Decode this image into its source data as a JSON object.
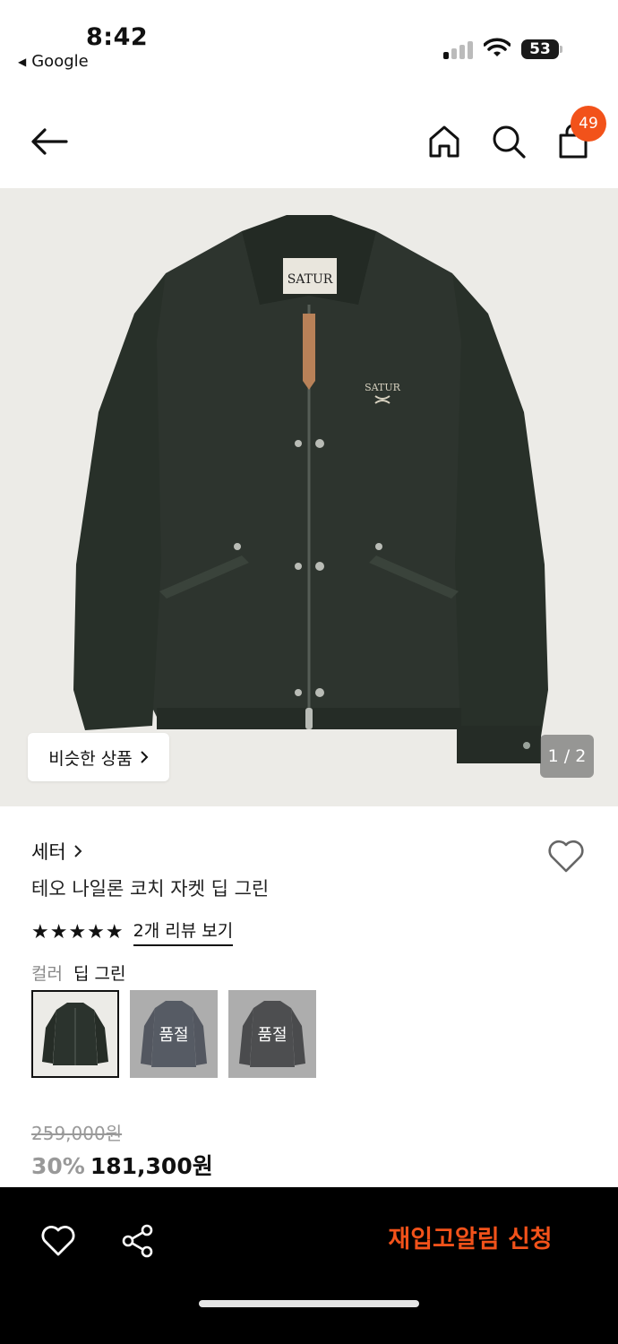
{
  "status_bar": {
    "time": "8:42",
    "back_app": "Google",
    "battery": "53"
  },
  "nav": {
    "cart_badge": "49",
    "icons": [
      "back-arrow-icon",
      "home-icon",
      "search-icon",
      "shopping-bag-icon"
    ]
  },
  "hero": {
    "similar_label": "비슷한 상품",
    "page_indicator": "1 / 2",
    "jacket_tag": "SATUR",
    "jacket_logo": "SATUR"
  },
  "product": {
    "brand": "세터",
    "name": "테오 나일론 코치 자켓 딥 그린",
    "stars": "★★★★★",
    "rating": 5,
    "review_link": "2개 리뷰 보기",
    "color_label": "컬러",
    "color_value": "딥 그린",
    "swatches": [
      {
        "color": "#2b332d",
        "sold_out": false,
        "label": ""
      },
      {
        "color": "#3b4455",
        "sold_out": true,
        "label": "품절"
      },
      {
        "color": "#2a2c30",
        "sold_out": true,
        "label": "품절"
      }
    ],
    "original_price": "259,000원",
    "discount": "30%",
    "sale_price": "181,300원"
  },
  "bottom_bar": {
    "restock_label": "재입고알림 신청"
  },
  "colors": {
    "accent": "#f2521a",
    "jacket": "#2d342e",
    "hero_bg": "#ecebe7"
  }
}
